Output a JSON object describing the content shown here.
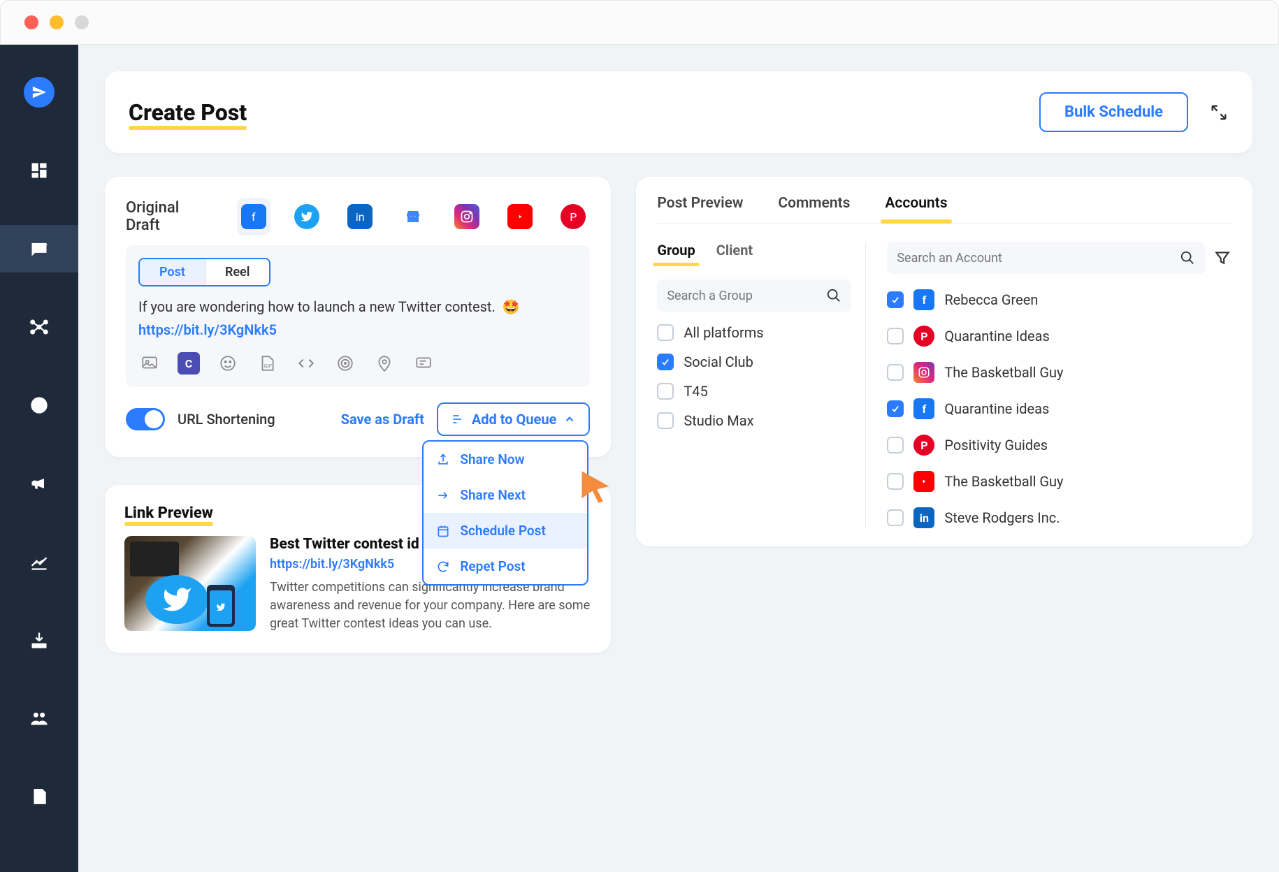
{
  "page": {
    "title": "Create Post",
    "bulk_schedule": "Bulk Schedule"
  },
  "compose": {
    "original_draft": "Original Draft",
    "type_post": "Post",
    "type_reel": "Reel",
    "text": "If you are wondering how to launch a new Twitter contest.",
    "emoji": "🤩",
    "link": "https://bit.ly/3KgNkk5",
    "url_shortening": "URL Shortening",
    "save_draft": "Save as Draft",
    "add_to_queue": "Add to Queue",
    "dropdown": {
      "share_now": "Share Now",
      "share_next": "Share Next",
      "schedule_post": "Schedule Post",
      "repeat_post": "Repet Post"
    }
  },
  "link_preview": {
    "section": "Link Preview",
    "headline": "Best Twitter contest id",
    "url": "https://bit.ly/3KgNkk5",
    "desc": "Twitter competitions can significantly increase brand awareness and revenue for your company. Here are some great Twitter contest ideas you can use."
  },
  "right": {
    "tabs": {
      "preview": "Post Preview",
      "comments": "Comments",
      "accounts": "Accounts"
    },
    "gc_tabs": {
      "group": "Group",
      "client": "Client"
    },
    "group_search_placeholder": "Search a Group",
    "account_search_placeholder": "Search an Account",
    "groups": [
      {
        "label": "All platforms",
        "checked": false
      },
      {
        "label": "Social Club",
        "checked": true
      },
      {
        "label": "T45",
        "checked": false
      },
      {
        "label": "Studio Max",
        "checked": false
      }
    ],
    "accounts": [
      {
        "label": "Rebecca Green",
        "network": "fb",
        "checked": true
      },
      {
        "label": "Quarantine Ideas",
        "network": "pin",
        "checked": false
      },
      {
        "label": "The Basketball Guy",
        "network": "ig",
        "checked": false
      },
      {
        "label": "Quarantine ideas",
        "network": "fb",
        "checked": true
      },
      {
        "label": "Positivity Guides",
        "network": "pin",
        "checked": false
      },
      {
        "label": "The Basketball Guy",
        "network": "yt",
        "checked": false
      },
      {
        "label": "Steve Rodgers Inc.",
        "network": "li",
        "checked": false
      }
    ]
  }
}
